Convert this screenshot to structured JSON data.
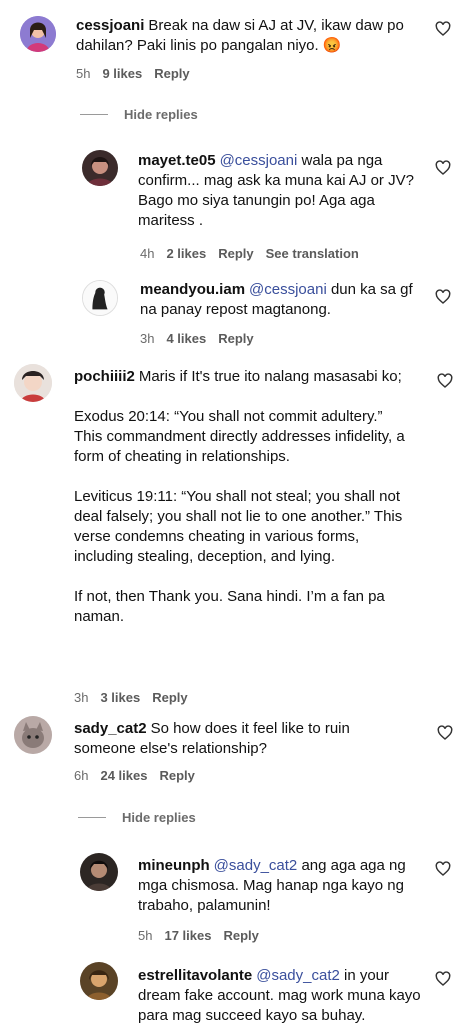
{
  "comments": [
    {
      "username": "cessjoani",
      "text": "Break na daw si AJ at JV, ikaw daw po dahilan? Paki linis po pangalan niyo. 😡",
      "time": "5h",
      "likes": "9 likes",
      "reply": "Reply",
      "avatar_icon": "user-avatar-icon"
    },
    {
      "username": "mayet.te05",
      "mention": "@cessjoani",
      "text": " wala pa nga confirm... mag ask ka muna kai AJ or JV? Bago mo siya tanungin po! Aga aga maritess .",
      "time": "4h",
      "likes": "2 likes",
      "reply": "Reply",
      "translate": "See translation"
    },
    {
      "username": "meandyou.iam",
      "mention": "@cessjoani",
      "text": " dun ka sa gf na panay repost magtanong.",
      "time": "3h",
      "likes": "4 likes",
      "reply": "Reply"
    },
    {
      "username": "pochiiii2",
      "paragraphs": [
        "Maris if It's true ito nalang masasabi ko;",
        "Exodus 20:14: “You shall not commit adultery.” This commandment directly addresses infidelity, a form of cheating in relationships.",
        "Leviticus 19:11: “You shall not steal; you shall not deal falsely; you shall not lie to one another.” This verse condemns cheating in various forms, including stealing, deception, and lying.",
        "If not, then Thank you. Sana hindi. I’m a fan pa naman."
      ],
      "time": "3h",
      "likes": "3 likes",
      "reply": "Reply"
    },
    {
      "username": "sady_cat2",
      "text": "So how does it feel like to ruin someone else's relationship?",
      "time": "6h",
      "likes": "24 likes",
      "reply": "Reply"
    },
    {
      "username": "mineunph",
      "mention": "@sady_cat2",
      "text": " ang aga aga ng mga chismosa. Mag hanap nga kayo ng trabaho, palamunin!",
      "time": "5h",
      "likes": "17 likes",
      "reply": "Reply"
    },
    {
      "username": "estrellitavolante",
      "mention": "@sady_cat2",
      "text": " in your dream fake account. mag work muna kayo para mag succeed kayo sa buhay.",
      "time": "",
      "likes": "",
      "reply": ""
    }
  ],
  "hide_replies_label": "Hide replies",
  "colors": {
    "mention": "#3a4f9c",
    "meta": "#6b6b6b"
  }
}
